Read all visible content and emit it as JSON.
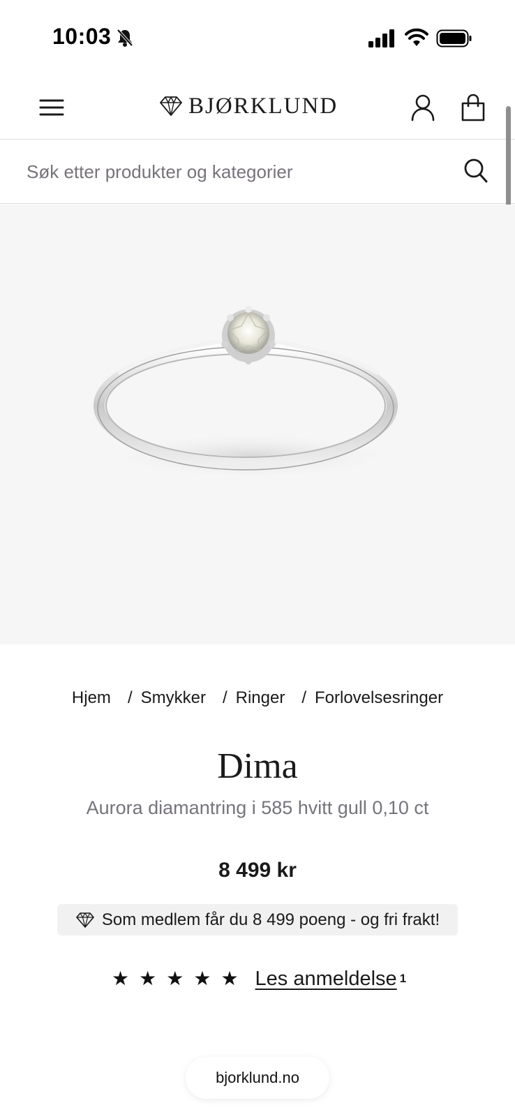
{
  "status_bar": {
    "time": "10:03",
    "bell_icon": "bell-slash-icon",
    "signal_icon": "cellular-signal-icon",
    "wifi_icon": "wifi-icon",
    "battery_icon": "battery-icon"
  },
  "header": {
    "menu_icon": "hamburger-menu-icon",
    "logo_text": "BJØRKLUND",
    "logo_icon": "diamond-icon",
    "account_icon": "user-icon",
    "cart_icon": "shopping-bag-icon"
  },
  "search": {
    "placeholder": "Søk etter produkter og kategorier",
    "value": "",
    "icon": "search-icon"
  },
  "hero": {
    "image_alt": "Diamond solitaire ring in white gold"
  },
  "breadcrumb": {
    "separator": "/",
    "items": [
      "Hjem",
      "Smykker",
      "Ringer",
      "Forlovelsesringer"
    ]
  },
  "product": {
    "name": "Dima",
    "description": "Aurora diamantring i 585 hvitt gull 0,10 ct",
    "price": "8 499 kr",
    "member_text": "Som medlem får du 8 499 poeng - og fri frakt!",
    "rating_stars": 5,
    "star_glyph": "★",
    "reviews_label": "Les anmeldelse",
    "reviews_count": "1"
  },
  "browser": {
    "url": "bjorklund.no"
  },
  "colors": {
    "accent": "#1a1a1a",
    "muted_text": "#76737b",
    "hero_bg": "#f6f6f6",
    "banner_bg": "#f1f1f1"
  }
}
